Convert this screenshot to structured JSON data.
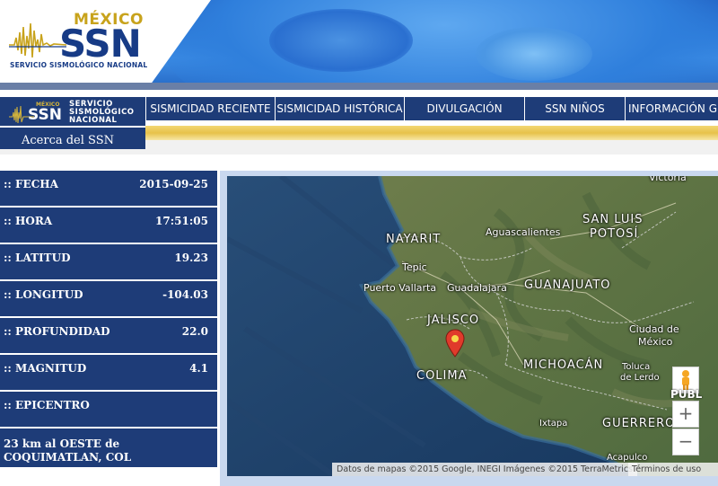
{
  "header": {
    "country": "MÉXICO",
    "acronym": "SSN",
    "full_name": "SERVICIO SISMOLÓGICO NACIONAL"
  },
  "nav": {
    "mini_country": "MÉXICO",
    "mini_acronym": "SSN",
    "mini_name": "SERVICIO SISMOLÓGICO NACIONAL",
    "about": "Acerca del SSN",
    "items": [
      {
        "label": "SISMICIDAD RECIENTE"
      },
      {
        "label": "SISMICIDAD HISTÓRICA"
      },
      {
        "label": "DIVULGACIÓN"
      },
      {
        "label": "SSN NIÑOS"
      },
      {
        "label": "INFORMACIÓN GE"
      }
    ]
  },
  "quake": {
    "fecha_label": ":: FECHA",
    "fecha": "2015-09-25",
    "hora_label": ":: HORA",
    "hora": "17:51:05",
    "latitud_label": ":: LATITUD",
    "latitud": "19.23",
    "longitud_label": ":: LONGITUD",
    "longitud": "-104.03",
    "profundidad_label": ":: PROFUNDIDAD",
    "profundidad": "22.0",
    "magnitud_label": ":: MAGNITUD",
    "magnitud": "4.1",
    "epicentro_label": ":: EPICENTRO",
    "epicentro": "23 km al OESTE de COQUIMATLAN, COL"
  },
  "map": {
    "labels": {
      "victoria": "Victoria",
      "nayarit": "NAYARIT",
      "aguascalientes": "Aguascalientes",
      "san_luis": "SAN LUIS",
      "potosi": "POTOSÍ",
      "tepic": "Tepic",
      "puerto_vallarta": "Puerto Vallarta",
      "guadalajara": "Guadalajara",
      "guanajuato": "GUANAJUATO",
      "jalisco": "JALISCO",
      "ciudad_de": "Ciudad de",
      "mexico": "México",
      "colima": "COLIMA",
      "michoacan": "MICHOACÁN",
      "toluca": "Toluca",
      "de_lerdo": "de Lerdo",
      "ixtapa": "Ixtapa",
      "guerrero": "GUERRERO",
      "acapulco": "Acapulco",
      "pobl": "PUBL"
    },
    "zoom_in": "+",
    "zoom_out": "−",
    "attribution": "Datos de mapas ©2015 Google, INEGI Imágenes ©2015 TerraMetrics",
    "terms": "Términos de uso"
  },
  "colors": {
    "navy": "#1e3c78",
    "gold": "#c8a31c",
    "pin": "#e03a2b"
  }
}
